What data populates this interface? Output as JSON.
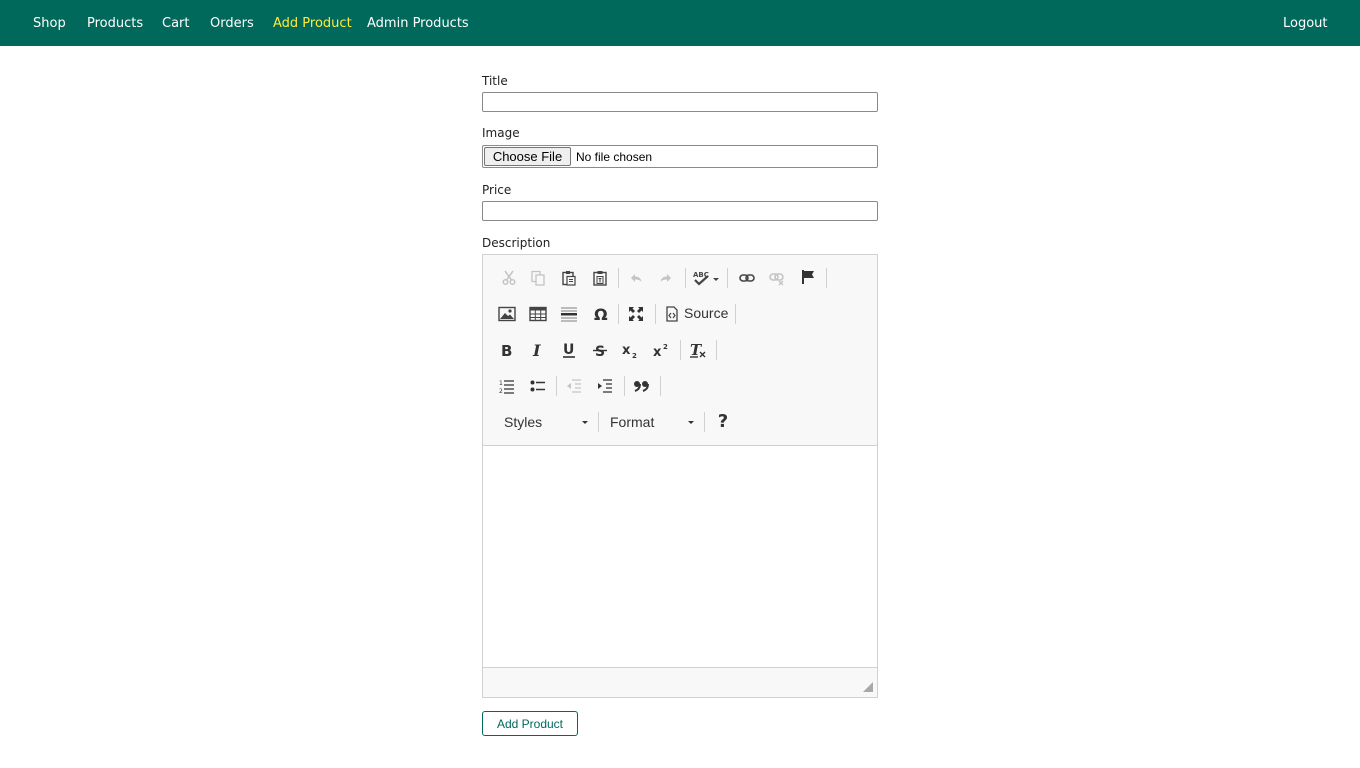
{
  "nav": {
    "items": [
      {
        "label": "Shop"
      },
      {
        "label": "Products"
      },
      {
        "label": "Cart"
      },
      {
        "label": "Orders"
      },
      {
        "label": "Add Product",
        "active": true
      },
      {
        "label": "Admin Products"
      }
    ],
    "logout": "Logout",
    "background_color": "#00695c",
    "active_color": "#ffeb3b"
  },
  "form": {
    "title_label": "Title",
    "title_value": "",
    "image_label": "Image",
    "file_button": "Choose File",
    "file_status": "No file chosen",
    "price_label": "Price",
    "price_value": "",
    "description_label": "Description",
    "submit": "Add Product"
  },
  "editor": {
    "toolbar_row1": [
      "cut-icon",
      "copy-icon",
      "paste-icon",
      "paste-as-text-icon",
      "undo-icon",
      "redo-icon",
      "spellcheck-icon",
      "link-icon",
      "unlink-icon",
      "anchor-icon"
    ],
    "toolbar_row2": [
      "image-icon",
      "table-icon",
      "horizontal-line-icon",
      "special-char-icon",
      "maximize-icon",
      "source-icon"
    ],
    "source_label": "Source",
    "toolbar_row3": [
      "bold-icon",
      "italic-icon",
      "underline-icon",
      "strike-icon",
      "subscript-icon",
      "superscript-icon",
      "remove-format-icon"
    ],
    "toolbar_row4": [
      "numbered-list-icon",
      "bulleted-list-icon",
      "outdent-icon",
      "indent-icon",
      "blockquote-icon"
    ],
    "styles_label": "Styles",
    "format_label": "Format",
    "help_label": "?",
    "content": ""
  }
}
